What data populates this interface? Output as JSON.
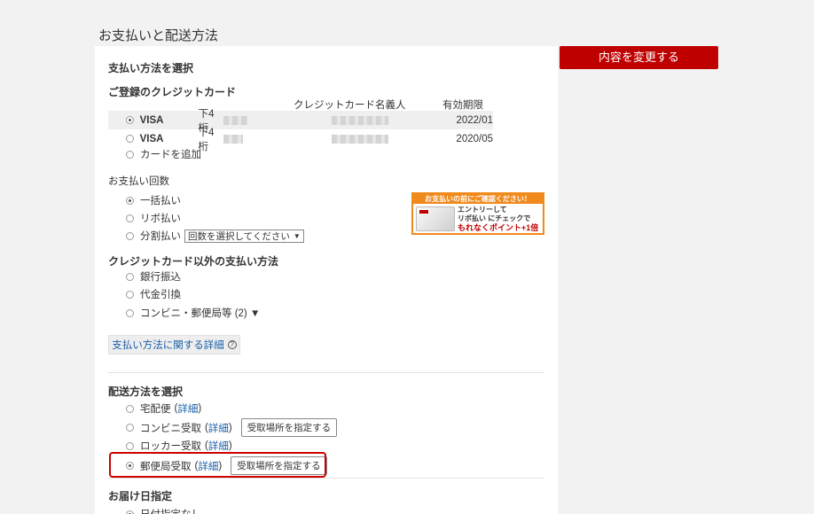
{
  "page": {
    "title": "お支払いと配送方法"
  },
  "change_button": "内容を変更する",
  "payment": {
    "title": "支払い方法を選択",
    "registered_title": "ご登録のクレジットカード",
    "col_name": "クレジットカード名義人",
    "col_expiry": "有効期限",
    "cards": [
      {
        "brand": "VISA",
        "last4_label": "下4桁",
        "expiry": "2022/01",
        "selected": true
      },
      {
        "brand": "VISA",
        "last4_label": "下4桁",
        "expiry": "2020/05",
        "selected": false
      }
    ],
    "add_card": "カードを追加",
    "installments_title": "お支払い回数",
    "installments": {
      "lump": "一括払い",
      "revolving": "リボ払い",
      "split": "分割払い",
      "split_select": "回数を選択してください"
    },
    "other_title": "クレジットカード以外の支払い方法",
    "other": {
      "bank": "銀行振込",
      "cod": "代金引換",
      "convenience": "コンビニ・郵便局等 (2) ▼"
    },
    "details_button": "支払い方法に関する詳細"
  },
  "banner": {
    "header": "お支払いの前にご確認ください！",
    "line1": "エントリーして",
    "line2": "リボ払い にチェックで",
    "line3": "もれなくポイント+1倍"
  },
  "shipping": {
    "title": "配送方法を選択",
    "detail_link": "詳細",
    "specify_button": "受取場所を指定する",
    "options": {
      "home": "宅配便",
      "convenience": "コンビニ受取",
      "locker": "ロッカー受取",
      "post": "郵便局受取"
    }
  },
  "delivery": {
    "title": "お届け日指定",
    "none": "日付指定なし"
  }
}
